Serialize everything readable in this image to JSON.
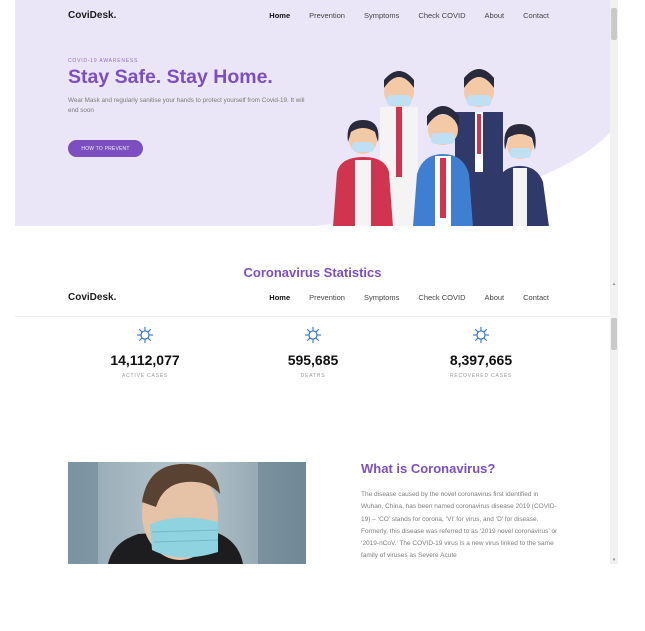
{
  "nav": {
    "brand": "CoviDesk.",
    "links": [
      "Home",
      "Prevention",
      "Symptoms",
      "Check COVID",
      "About",
      "Contact"
    ],
    "active": "Home"
  },
  "hero": {
    "eyebrow": "COVID-19 AWARENESS",
    "title": "Stay Safe. Stay Home.",
    "text": "Wear Mask and regularly sanitise your hands to protect yourself from Covid-19. It will end soon",
    "button": "HOW TO PREVENT",
    "illustration": "group-of-people-wearing-masks"
  },
  "statistics": {
    "title": "Coronavirus Statistics",
    "items": [
      {
        "value": "14,112,077",
        "label": "ACTIVE CASES",
        "icon": "virus-icon"
      },
      {
        "value": "595,685",
        "label": "DEATHS",
        "icon": "virus-icon"
      },
      {
        "value": "8,397,665",
        "label": "RECOVERED CASES",
        "icon": "virus-icon"
      }
    ]
  },
  "about": {
    "title": "What is Coronavirus?",
    "text": "The disease caused by the novel coronavirus first identified in Wuhan, China, has been named coronavirus disease 2019 (COVID-19) – ‘CO’ stands for corona, ‘VI’ for virus, and ‘D’ for disease. Formerly, this disease was referred to as ‘2019 novel coronavirus’ or ‘2019-nCoV.’ The COVID-19 virus is a new virus linked to the same family of viruses as Severe Acute",
    "image": "man-wearing-face-mask-photo"
  },
  "colors": {
    "accent": "#7b4fbf",
    "hero_bg": "#ebe6f7",
    "icon_blue": "#2f6fd6"
  }
}
